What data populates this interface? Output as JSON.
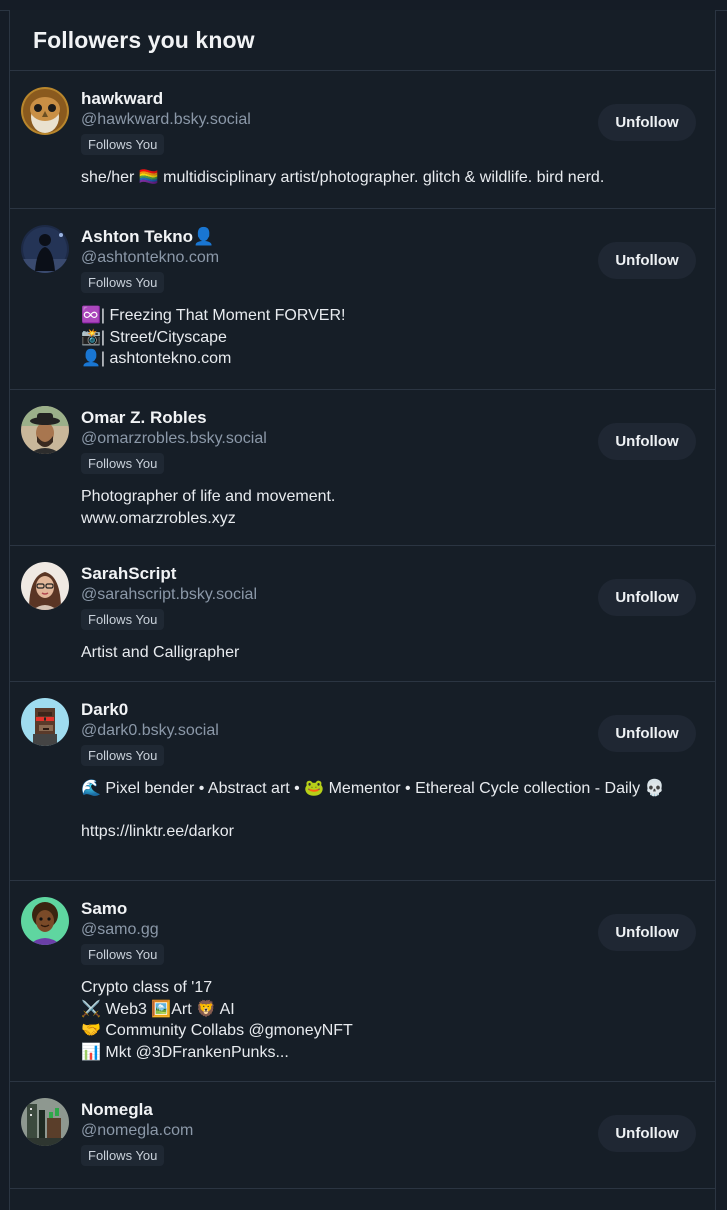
{
  "page": {
    "title": "Followers you know"
  },
  "follow_badge": "Follows You",
  "unfollow_label": "Unfollow",
  "colors": {
    "background": "#161e27",
    "divider": "#2b3542",
    "handle": "#8b98a8",
    "button_bg": "#1f2733",
    "badge_bg": "#1f2833"
  },
  "followers": [
    {
      "name": "hawkward",
      "handle": "@hawkward.bsky.social",
      "badge": "Follows You",
      "bio": "she/her 🏳️‍🌈 multidisciplinary artist/photographer. glitch & wildlife. bird nerd.",
      "avatar_icon": "owl-avatar"
    },
    {
      "name": "Ashton Tekno👤",
      "handle": "@ashtontekno.com",
      "badge": "Follows You",
      "bio": "♾️| Freezing That Moment FORVER!\n📸| Street/Cityscape\n👤| ashtontekno.com",
      "avatar_icon": "silhouette-avatar"
    },
    {
      "name": "Omar Z. Robles",
      "handle": "@omarzrobles.bsky.social",
      "badge": "Follows You",
      "bio": "Photographer of life and movement.\nwww.omarzrobles.xyz",
      "avatar_icon": "hat-portrait-avatar"
    },
    {
      "name": "SarahScript",
      "handle": "@sarahscript.bsky.social",
      "badge": "Follows You",
      "bio": "Artist and Calligrapher",
      "avatar_icon": "portrait-avatar"
    },
    {
      "name": "Dark0",
      "handle": "@dark0.bsky.social",
      "badge": "Follows You",
      "bio": "🌊 Pixel bender • Abstract art • 🐸 Mementor • Ethereal Cycle collection - Daily 💀\n\nhttps://linktr.ee/darkor",
      "avatar_icon": "pixel-ape-avatar"
    },
    {
      "name": "Samo",
      "handle": "@samo.gg",
      "badge": "Follows You",
      "bio": "Crypto class of '17\n⚔️ Web3 🖼️Art 🦁 AI\n🤝 Community Collabs @gmoneyNFT\n📊 Mkt @3DFrankenPunks...",
      "avatar_icon": "cartoon-avatar"
    },
    {
      "name": "Nomegla",
      "handle": "@nomegla.com",
      "badge": "Follows You",
      "bio": "",
      "avatar_icon": "pixel-art-avatar"
    }
  ]
}
